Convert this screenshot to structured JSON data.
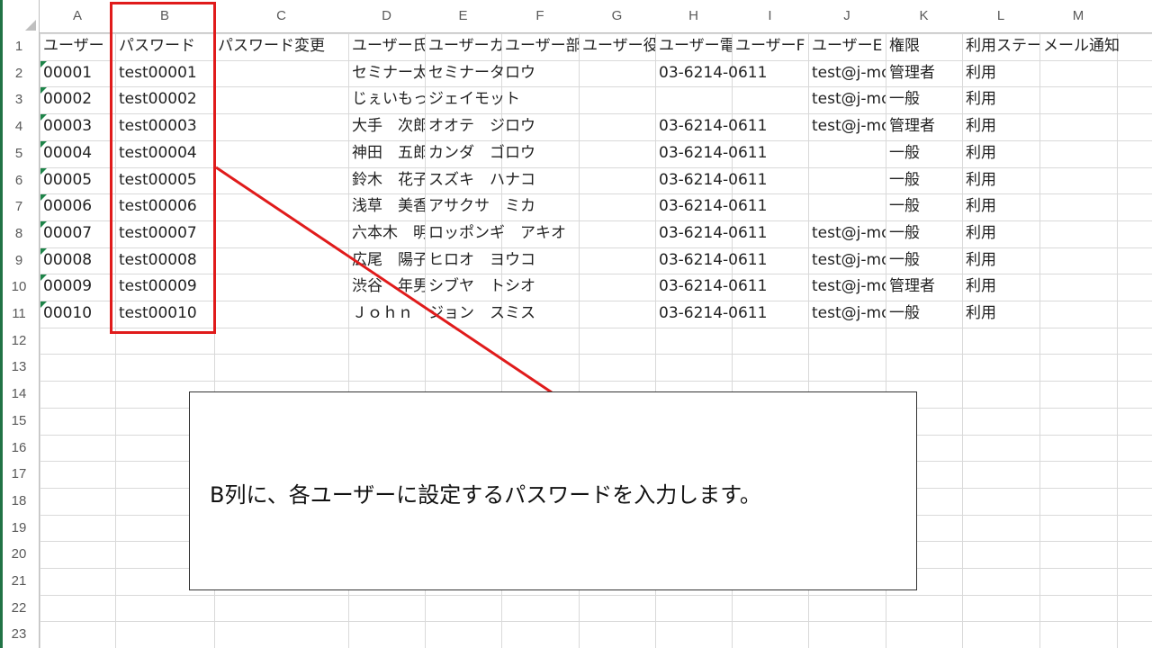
{
  "column_headers": [
    "A",
    "B",
    "C",
    "D",
    "E",
    "F",
    "G",
    "H",
    "I",
    "J",
    "K",
    "L",
    "M"
  ],
  "row_numbers": [
    "1",
    "2",
    "3",
    "4",
    "5",
    "6",
    "7",
    "8",
    "9",
    "10",
    "11",
    "12",
    "13",
    "14",
    "15",
    "16",
    "17",
    "18",
    "19",
    "20",
    "21",
    "22",
    "23"
  ],
  "header_row": [
    "ユーザー",
    "パスワード",
    "パスワード変更",
    "ユーザー氏",
    "ユーザーカ",
    "ユーザー部",
    "ユーザー役",
    "ユーザー電",
    "ユーザーF",
    "ユーザーE",
    "権限",
    "利用ステー",
    "メール通知"
  ],
  "data_rows": [
    [
      "00001",
      "test00001",
      "",
      "セミナー太",
      "セミナータロウ",
      "",
      "",
      "03-6214-0611",
      "",
      "test@j-mo",
      "管理者",
      "利用",
      ""
    ],
    [
      "00002",
      "test00002",
      "",
      "じぇいもっ",
      "ジェイモット",
      "",
      "",
      "",
      "",
      "test@j-mo",
      "一般",
      "利用",
      ""
    ],
    [
      "00003",
      "test00003",
      "",
      "大手　次郎",
      "オオテ　ジロウ",
      "",
      "",
      "03-6214-0611",
      "",
      "test@j-mo",
      "管理者",
      "利用",
      ""
    ],
    [
      "00004",
      "test00004",
      "",
      "神田　五郎",
      "カンダ　ゴロウ",
      "",
      "",
      "03-6214-0611",
      "",
      "",
      "一般",
      "利用",
      ""
    ],
    [
      "00005",
      "test00005",
      "",
      "鈴木　花子",
      "スズキ　ハナコ",
      "",
      "",
      "03-6214-0611",
      "",
      "",
      "一般",
      "利用",
      ""
    ],
    [
      "00006",
      "test00006",
      "",
      "浅草　美香",
      "アサクサ　ミカ",
      "",
      "",
      "03-6214-0611",
      "",
      "",
      "一般",
      "利用",
      ""
    ],
    [
      "00007",
      "test00007",
      "",
      "六本木　明",
      "ロッポンギ　アキオ",
      "",
      "",
      "03-6214-0611",
      "",
      "test@j-mo",
      "一般",
      "利用",
      ""
    ],
    [
      "00008",
      "test00008",
      "",
      "広尾　陽子",
      "ヒロオ　ヨウコ",
      "",
      "",
      "03-6214-0611",
      "",
      "test@j-mo",
      "一般",
      "利用",
      ""
    ],
    [
      "00009",
      "test00009",
      "",
      "渋谷　年男",
      "シブヤ　トシオ",
      "",
      "",
      "03-6214-0611",
      "",
      "test@j-mo",
      "管理者",
      "利用",
      ""
    ],
    [
      "00010",
      "test00010",
      "",
      "Ｊｏｈｎ",
      "ジョン　スミス",
      "",
      "",
      "03-6214-0611",
      "",
      "test@j-mo",
      "一般",
      "利用",
      ""
    ]
  ],
  "callout": {
    "text": "B列に、各ユーザーに設定するパスワードを入力します。"
  },
  "colors": {
    "highlight": "#e01b1b",
    "error_triangle": "#1e8449",
    "grid": "#d9d9d9"
  }
}
